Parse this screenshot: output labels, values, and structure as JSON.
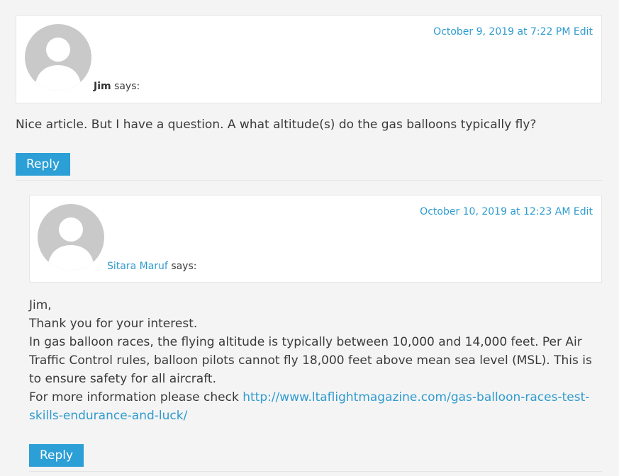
{
  "comments": [
    {
      "author": "Jim",
      "says": "says:",
      "date": "October 9, 2019 at 7:22 PM",
      "edit_label": "Edit",
      "body": "Nice article. But I have a question. A what altitude(s) do the gas balloons typically fly?",
      "reply_label": "Reply"
    },
    {
      "author": "Sitara Maruf",
      "says": "says:",
      "date": "October 10, 2019 at 12:23 AM",
      "edit_label": "Edit",
      "body_lines": [
        "Jim,",
        "Thank you for your interest.",
        "In gas balloon races, the flying altitude is typically between 10,000 and 14,000 feet. Per Air Traffic Control rules, balloon pilots cannot fly 18,000 feet above mean sea level (MSL). This is to ensure safety for all aircraft.",
        "For more information please check"
      ],
      "link_text": "http://www.ltaflightmagazine.com/gas-balloon-races-test-skills-endurance-and-luck/",
      "reply_label": "Reply"
    }
  ],
  "colors": {
    "accent": "#2b9fd6",
    "link": "#2f9bd0",
    "background": "#f4f4f4",
    "avatar": "#c9c9c9"
  },
  "icons": {
    "avatar": "default-user-avatar-icon"
  }
}
